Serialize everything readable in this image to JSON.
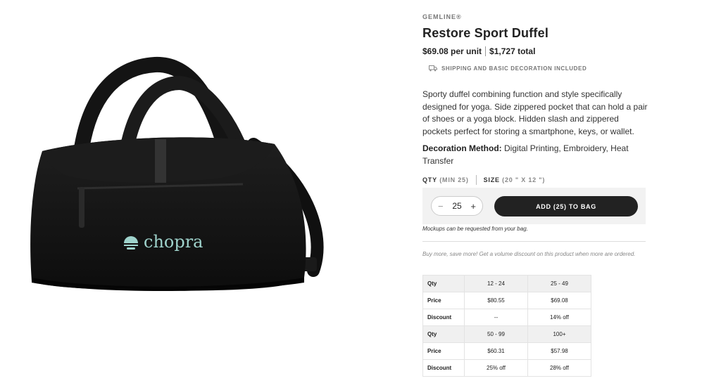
{
  "product": {
    "brand": "GEMLINE®",
    "name": "Restore Sport Duffel",
    "price_unit": "$69.08 per unit",
    "price_total": "$1,727 total",
    "shipping_note": "SHIPPING AND BASIC DECORATION INCLUDED",
    "shipping_icon": "truck-icon",
    "description": "Sporty duffel combining function and style specifically designed for yoga. Side zippered pocket that can hold a pair of shoes or a yoga block. Hidden slash and zippered pockets perfect for storing a smartphone, keys, or wallet.",
    "decoration_label": "Decoration Method:",
    "decoration_value": "Digital Printing, Embroidery, Heat Transfer",
    "image_logo_text": "chopra"
  },
  "purchase": {
    "qty_label": "QTY",
    "qty_min": "(MIN 25)",
    "size_label": "SIZE",
    "size_value": "(20 \" X 12 \")",
    "minus": "−",
    "plus": "+",
    "quantity": "25",
    "add_button": "ADD (25) TO BAG",
    "mockup_note": "Mockups can be requested from your bag."
  },
  "volume": {
    "note": "Buy more, save more! Get a volume discount on this product when more are ordered.",
    "rows": [
      {
        "label": "Qty",
        "a": "12 - 24",
        "b": "25 - 49"
      },
      {
        "label": "Price",
        "a": "$80.55",
        "b": "$69.08"
      },
      {
        "label": "Discount",
        "a": "--",
        "b": "14% off"
      },
      {
        "label": "Qty",
        "a": "50 - 99",
        "b": "100+"
      },
      {
        "label": "Price",
        "a": "$60.31",
        "b": "$57.98"
      },
      {
        "label": "Discount",
        "a": "25% off",
        "b": "28% off"
      }
    ]
  },
  "colors": {
    "button_bg": "#222222",
    "logo_teal": "#9fd3cc",
    "table_qty_bg": "#f0f0f0"
  }
}
